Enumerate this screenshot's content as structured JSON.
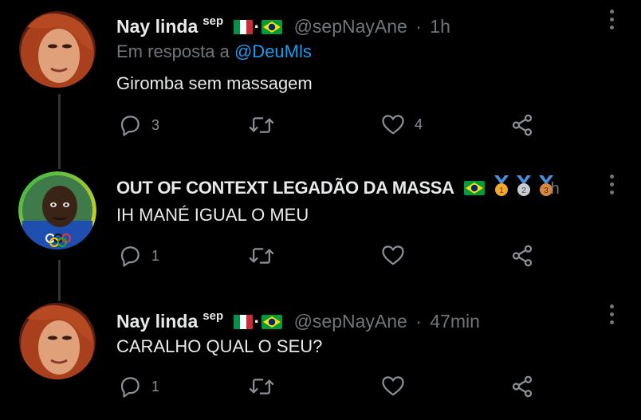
{
  "tweets": [
    {
      "name": "Nay linda",
      "name_sup": "sep",
      "handle": "@sepNayAne",
      "time": "1h",
      "reply_prefix": "Em resposta a",
      "reply_mention": "@DeuMls",
      "text": "Giromba sem massagem",
      "replies": "3",
      "retweets": "",
      "likes": "4",
      "flags": [
        "italy-flag",
        "brazil-flag"
      ]
    },
    {
      "name": "OUT OF CONTEXT LEGADÃO DA MASSA",
      "time_fragment": "h",
      "text": "IH MANÉ IGUAL O MEU",
      "replies": "1",
      "retweets": "",
      "likes": "",
      "flags": [
        "brazil-flag"
      ],
      "medals": [
        "1",
        "2",
        "3"
      ]
    },
    {
      "name": "Nay linda",
      "name_sup": "sep",
      "handle": "@sepNayAne",
      "time": "47min",
      "text": "CARALHO QUAL O SEU?",
      "replies": "1",
      "retweets": "",
      "likes": "",
      "flags": [
        "italy-flag",
        "brazil-flag"
      ]
    }
  ],
  "separator": "·",
  "icons": [
    "reply-icon",
    "retweet-icon",
    "like-icon",
    "share-icon",
    "more-options-icon"
  ],
  "colors": {
    "background": "#000000",
    "text": "#e7e9ea",
    "muted": "#71767b",
    "link": "#1d9bf0",
    "line": "#2f3336"
  }
}
